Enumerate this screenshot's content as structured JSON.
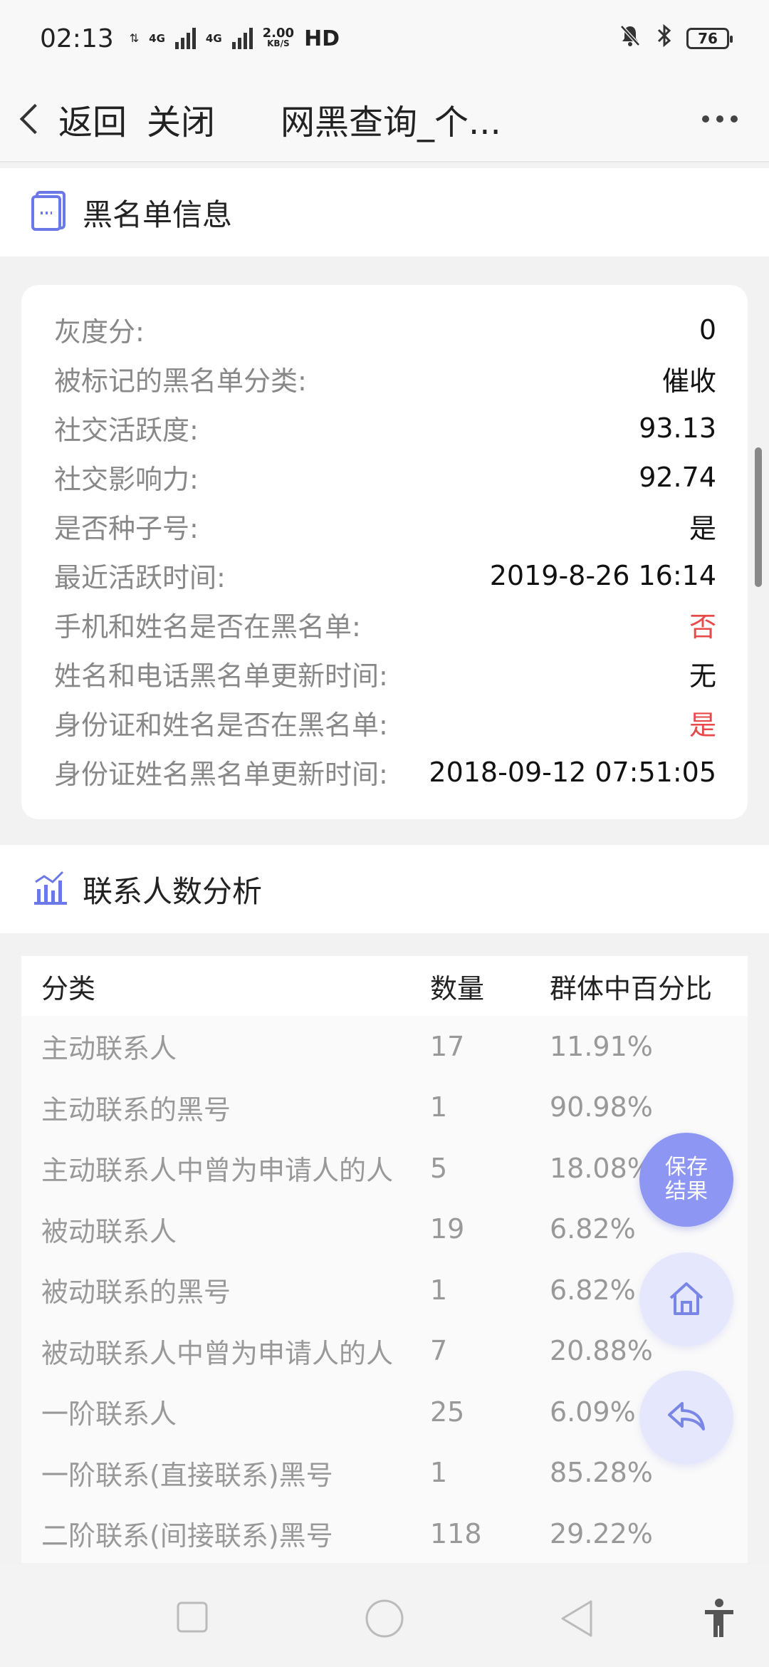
{
  "status_bar": {
    "time": "02:13",
    "net1": "4G",
    "net2": "4G",
    "speed_value": "2.00",
    "speed_unit": "KB/S",
    "hd": "HD",
    "battery": "76"
  },
  "nav": {
    "back_label": "返回",
    "close_label": "关闭",
    "title": "网黑查询_个..."
  },
  "section1": {
    "title": "黑名单信息"
  },
  "info_rows": [
    {
      "label": "灰度分:",
      "value": "0"
    },
    {
      "label": "被标记的黑名单分类:",
      "value": "催收"
    },
    {
      "label": "社交活跃度:",
      "value": "93.13"
    },
    {
      "label": "社交影响力:",
      "value": "92.74"
    },
    {
      "label": "是否种子号:",
      "value": "是"
    },
    {
      "label": "最近活跃时间:",
      "value": "2019-8-26 16:14"
    },
    {
      "label": "手机和姓名是否在黑名单:",
      "value": "否"
    },
    {
      "label": "姓名和电话黑名单更新时间:",
      "value": "无"
    },
    {
      "label": "身份证和姓名是否在黑名单:",
      "value": "是"
    },
    {
      "label": "身份证姓名黑名单更新时间:",
      "value": "2018-09-12 07:51:05"
    }
  ],
  "section2": {
    "title": "联系人数分析"
  },
  "table": {
    "headers": [
      "分类",
      "数量",
      "群体中百分比"
    ],
    "rows": [
      [
        "主动联系人",
        "17",
        "11.91%"
      ],
      [
        "主动联系的黑号",
        "1",
        "90.98%"
      ],
      [
        "主动联系人中曾为申请人的人",
        "5",
        "18.08%"
      ],
      [
        "被动联系人",
        "19",
        "6.82%"
      ],
      [
        "被动联系的黑号",
        "1",
        "6.82%"
      ],
      [
        "被动联系人中曾为申请人的人",
        "7",
        "20.88%"
      ],
      [
        "一阶联系人",
        "25",
        "6.09%"
      ],
      [
        "一阶联系(直接联系)黑号",
        "1",
        "85.28%"
      ],
      [
        "二阶联系(间接联系)黑号",
        "118",
        "29.22%"
      ]
    ]
  },
  "fab": {
    "save_line1": "保存",
    "save_line2": "结果"
  },
  "colors": {
    "accent": "#8d96f2",
    "red": "#e84a4a",
    "icon_blue": "#6b78e8"
  }
}
